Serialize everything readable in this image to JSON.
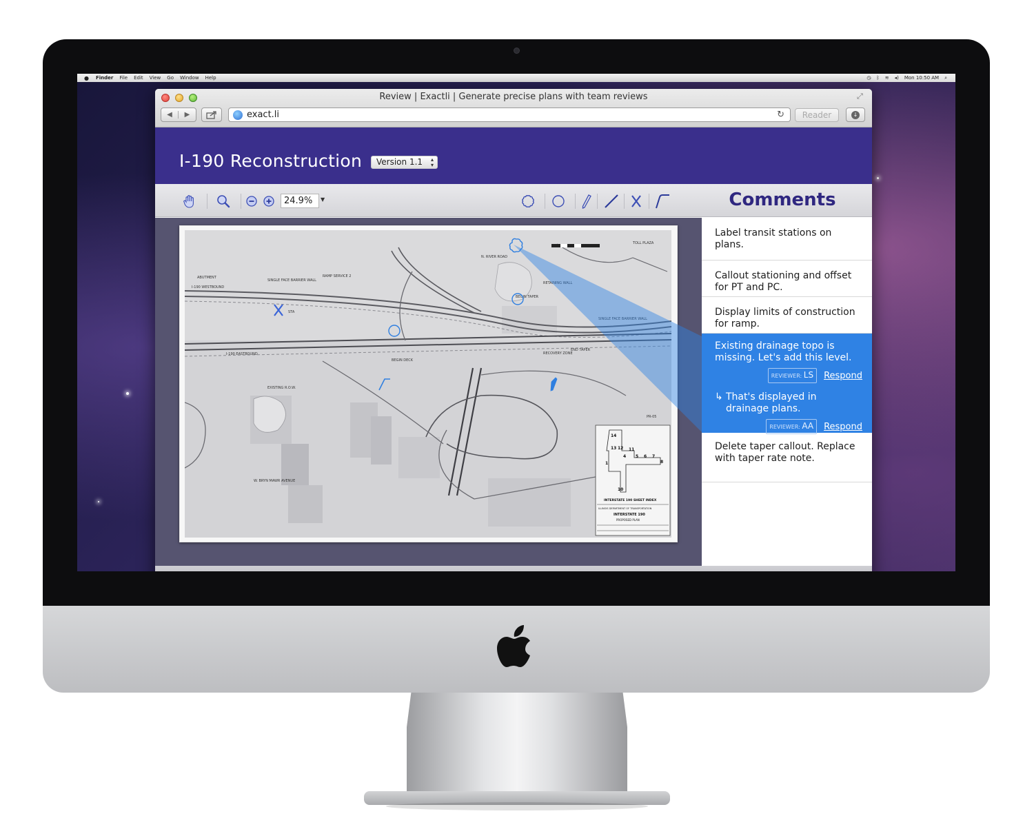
{
  "desktop": {
    "menubar": {
      "items": [
        "Finder",
        "File",
        "Edit",
        "View",
        "Go",
        "Window",
        "Help"
      ],
      "clock": "Mon 10:50 AM"
    }
  },
  "browser": {
    "window_title": "Review | Exactli | Generate precise plans with team reviews",
    "url": "exact.li",
    "reader_label": "Reader"
  },
  "app": {
    "project_title": "I-190 Reconstruction",
    "version_label": "Version 1.1",
    "zoom_value": "24.9%",
    "comments_heading": "Comments",
    "accent_color": "#3a2f8c",
    "highlight_color": "#2f82e4",
    "tools": [
      "hand-icon",
      "zoom-magnifier-icon",
      "zoom-out-icon",
      "zoom-in-icon",
      "cloud-shape-icon",
      "circle-shape-icon",
      "pencil-icon",
      "line-icon",
      "x-mark-icon",
      "polyline-icon"
    ],
    "comments": [
      {
        "text": "Label transit stations on plans."
      },
      {
        "text": "Callout stationing and offset for PT and PC."
      },
      {
        "text": "Display limits of construction for ramp."
      },
      {
        "text": "Existing drainage topo is missing. Let's add this level.",
        "reviewer_prefix": "REVIEWER:",
        "reviewer": "LS",
        "respond_label": "Respond",
        "reply_arrow": "↳",
        "reply_text": "That's displayed in drainage plans.",
        "reply_reviewer_prefix": "REVIEWER:",
        "reply_reviewer": "AA",
        "reply_respond_label": "Respond"
      },
      {
        "text": "Delete taper callout. Replace with taper rate note."
      }
    ]
  },
  "plan_sheet": {
    "labels": [
      "ABUTMENT",
      "SINGLE FACE BARRIER WALL",
      "RAMP SERVICE 2",
      "BEGIN TAPER",
      "I-190 WESTBOUND",
      "I-190 EASTBOUND",
      "RETAINING WALL",
      "SINGLE FACE BARRIER WALL",
      "END TAPER",
      "EXISTING R.O.W.",
      "N. RIVER ROAD",
      "TOLL PLAZA",
      "RECOVERY ZONE",
      "BEGIN DECK",
      "STA",
      "W. BRYN MAWR AVENUE",
      "PR-05"
    ],
    "title_block": {
      "index_title": "INTERSTATE 190 SHEET INDEX",
      "agency": "ILLINOIS DEPARTMENT OF TRANSPORTATION",
      "route": "INTERSTATE 190",
      "sheet_name": "PROPOSED PLAN",
      "index_numbers": [
        "14",
        "13",
        "12",
        "11",
        "10",
        "1",
        "4",
        "5",
        "6",
        "7",
        "8"
      ]
    }
  }
}
